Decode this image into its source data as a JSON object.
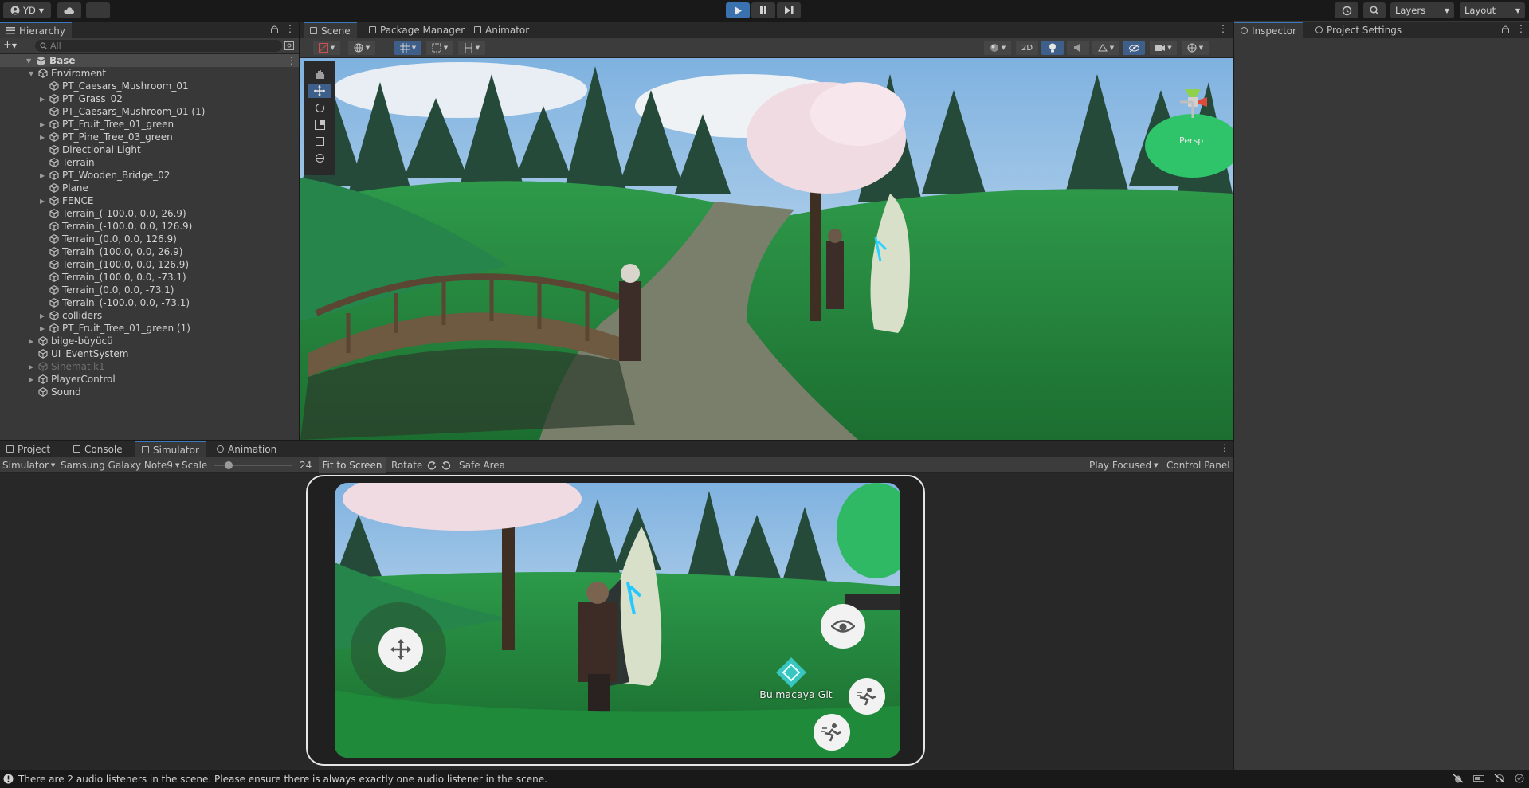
{
  "topbar": {
    "account": "YD",
    "layers": "Layers",
    "layout": "Layout"
  },
  "scene_tabs": [
    {
      "label": "Scene",
      "icon": "grid-icon"
    },
    {
      "label": "Package Manager",
      "icon": "package-icon"
    },
    {
      "label": "Animator",
      "icon": "animator-icon"
    }
  ],
  "hierarchy": {
    "title": "Hierarchy",
    "search_placeholder": "All",
    "root": "Base",
    "items": [
      {
        "label": "Enviroment",
        "indent": 1,
        "arrow": "down",
        "dim": false
      },
      {
        "label": "PT_Caesars_Mushroom_01",
        "indent": 2,
        "arrow": "",
        "dim": false
      },
      {
        "label": "PT_Grass_02",
        "indent": 2,
        "arrow": "right",
        "dim": false
      },
      {
        "label": "PT_Caesars_Mushroom_01 (1)",
        "indent": 2,
        "arrow": "",
        "dim": false
      },
      {
        "label": "PT_Fruit_Tree_01_green",
        "indent": 2,
        "arrow": "right",
        "dim": false
      },
      {
        "label": "PT_Pine_Tree_03_green",
        "indent": 2,
        "arrow": "right",
        "dim": false
      },
      {
        "label": "Directional Light",
        "indent": 2,
        "arrow": "",
        "dim": false
      },
      {
        "label": "Terrain",
        "indent": 2,
        "arrow": "",
        "dim": false
      },
      {
        "label": "PT_Wooden_Bridge_02",
        "indent": 2,
        "arrow": "right",
        "dim": false
      },
      {
        "label": "Plane",
        "indent": 2,
        "arrow": "",
        "dim": false
      },
      {
        "label": "FENCE",
        "indent": 2,
        "arrow": "right",
        "dim": false
      },
      {
        "label": "Terrain_(-100.0, 0.0, 26.9)",
        "indent": 2,
        "arrow": "",
        "dim": false
      },
      {
        "label": "Terrain_(-100.0, 0.0, 126.9)",
        "indent": 2,
        "arrow": "",
        "dim": false
      },
      {
        "label": "Terrain_(0.0, 0.0, 126.9)",
        "indent": 2,
        "arrow": "",
        "dim": false
      },
      {
        "label": "Terrain_(100.0, 0.0, 26.9)",
        "indent": 2,
        "arrow": "",
        "dim": false
      },
      {
        "label": "Terrain_(100.0, 0.0, 126.9)",
        "indent": 2,
        "arrow": "",
        "dim": false
      },
      {
        "label": "Terrain_(100.0, 0.0, -73.1)",
        "indent": 2,
        "arrow": "",
        "dim": false
      },
      {
        "label": "Terrain_(0.0, 0.0, -73.1)",
        "indent": 2,
        "arrow": "",
        "dim": false
      },
      {
        "label": "Terrain_(-100.0, 0.0, -73.1)",
        "indent": 2,
        "arrow": "",
        "dim": false
      },
      {
        "label": "colliders",
        "indent": 2,
        "arrow": "right",
        "dim": false
      },
      {
        "label": "PT_Fruit_Tree_01_green (1)",
        "indent": 2,
        "arrow": "right",
        "dim": false
      },
      {
        "label": "bilge-büyücü",
        "indent": 1,
        "arrow": "right",
        "dim": false
      },
      {
        "label": "UI_EventSystem",
        "indent": 1,
        "arrow": "",
        "dim": false
      },
      {
        "label": "Sinematik1",
        "indent": 1,
        "arrow": "right",
        "dim": true
      },
      {
        "label": "PlayerControl",
        "indent": 1,
        "arrow": "right",
        "dim": false
      },
      {
        "label": "Sound",
        "indent": 1,
        "arrow": "",
        "dim": false
      }
    ]
  },
  "scene_toolbar": {
    "btn_2d": "2D",
    "persp": "Persp"
  },
  "bottom_tabs": [
    {
      "label": "Project",
      "icon": "folder-icon"
    },
    {
      "label": "Console",
      "icon": "console-icon"
    },
    {
      "label": "Simulator",
      "icon": "simulator-icon"
    },
    {
      "label": "Animation",
      "icon": "clock-icon"
    }
  ],
  "simulator": {
    "mode": "Simulator",
    "device": "Samsung Galaxy Note9",
    "scale_label": "Scale",
    "scale_value": "24",
    "fit_to_screen": "Fit to Screen",
    "rotate": "Rotate",
    "safe_area": "Safe Area",
    "play_focused": "Play Focused",
    "control_panel": "Control Panel",
    "game_prompt": "Bulmacaya Git"
  },
  "inspector_tabs": [
    {
      "label": "Inspector",
      "icon": "info-icon"
    },
    {
      "label": "Project Settings",
      "icon": "gear-icon"
    }
  ],
  "status": {
    "message": "There are 2 audio listeners in the scene. Please ensure there is always exactly one audio listener in the scene."
  }
}
